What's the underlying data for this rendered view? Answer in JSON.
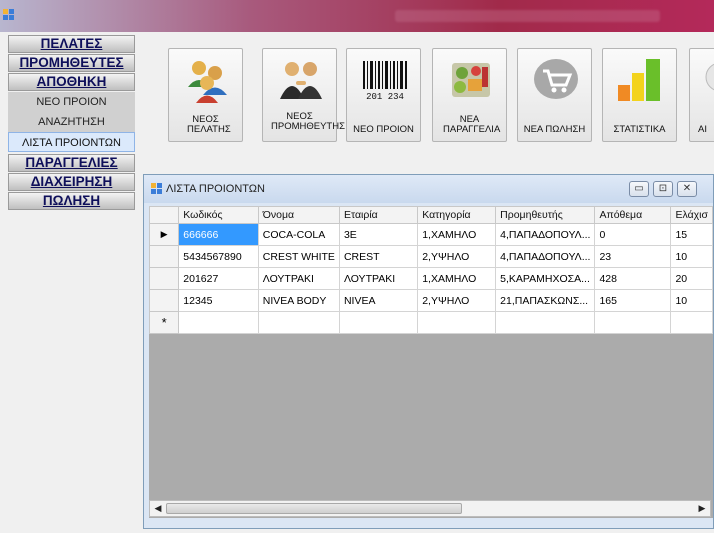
{
  "menu": {
    "items": [
      {
        "label": "ΠΕΛΑΤΕΣ"
      },
      {
        "label": "ΠΡΟΜΗΘΕΥΤΕΣ"
      },
      {
        "label": "ΑΠΟΘΗΚΗ"
      }
    ],
    "sub_items": [
      {
        "label": "ΝΕΟ ΠΡΟΙΟΝ"
      },
      {
        "label": "ΑΝΑΖΗΤΗΣΗ"
      },
      {
        "label": "ΛΙΣΤΑ ΠΡΟΙΟΝΤΩΝ"
      }
    ],
    "items2": [
      {
        "label": "ΠΑΡΑΓΓΕΛΙΕΣ"
      },
      {
        "label": "ΔΙΑΧΕΙΡΗΣΗ"
      },
      {
        "label": "ΠΩΛΗΣΗ"
      }
    ]
  },
  "toolbar": {
    "tiles": [
      {
        "label": "ΝΕΟΣ ΠΕΛΑΤΗΣ",
        "icon": "customers-icon"
      },
      {
        "label": "ΝΕΟΣ ΠΡΟΜΗΘΕΥΤΗΣ",
        "icon": "suppliers-icon"
      },
      {
        "label": "ΝΕΟ ΠΡΟΙΟΝ",
        "icon": "barcode-icon"
      },
      {
        "label": "ΝΕΑ ΠΑΡΑΓΓΕΛΙΑ",
        "icon": "groceries-icon"
      },
      {
        "label": "ΝΕΑ ΠΩΛΗΣΗ",
        "icon": "cart-icon"
      },
      {
        "label": "ΣΤΑΤΙΣΤΙΚΑ",
        "icon": "bar-chart-icon"
      },
      {
        "label": "ΑΙ",
        "icon": "partial-icon"
      }
    ],
    "barcode_digits": "201 234"
  },
  "product_list": {
    "title": "ΛΙΣΤΑ ΠΡΟΙΟΝΤΩΝ",
    "columns": [
      "Κωδικός",
      "Όνομα",
      "Εταιρία",
      "Κατηγορία",
      "Προμηθευτής",
      "Απόθεμα",
      "Ελάχισ"
    ],
    "rows": [
      {
        "indicator": "▶",
        "cells": [
          "666666",
          "COCA-COLA",
          "3E",
          "1,ΧΑΜΗΛΟ",
          "4,ΠΑΠΑΔΟΠΟΥΛ...",
          "0",
          "15"
        ]
      },
      {
        "indicator": "",
        "cells": [
          "5434567890",
          "CREST WHITE",
          "CREST",
          "2,ΥΨΗΛΟ",
          "4,ΠΑΠΑΔΟΠΟΥΛ...",
          "23",
          "10"
        ]
      },
      {
        "indicator": "",
        "cells": [
          "201627",
          "ΛΟΥΤΡΑΚΙ",
          "ΛΟΥΤΡΑΚΙ",
          "1,ΧΑΜΗΛΟ",
          "5,ΚΑΡΑΜΗΧΟΣΑ...",
          "428",
          "20"
        ]
      },
      {
        "indicator": "",
        "cells": [
          "12345",
          "NIVEA BODY",
          "NIVEA",
          "2,ΥΨΗΛΟ",
          "21,ΠΑΠΑΣΚΩΝΣ...",
          "165",
          "10"
        ]
      }
    ],
    "new_row_indicator": "*",
    "scroll_left": "◀",
    "scroll_right": "▶",
    "minimize": "▭",
    "maximize": "⊡",
    "close": "✕"
  }
}
